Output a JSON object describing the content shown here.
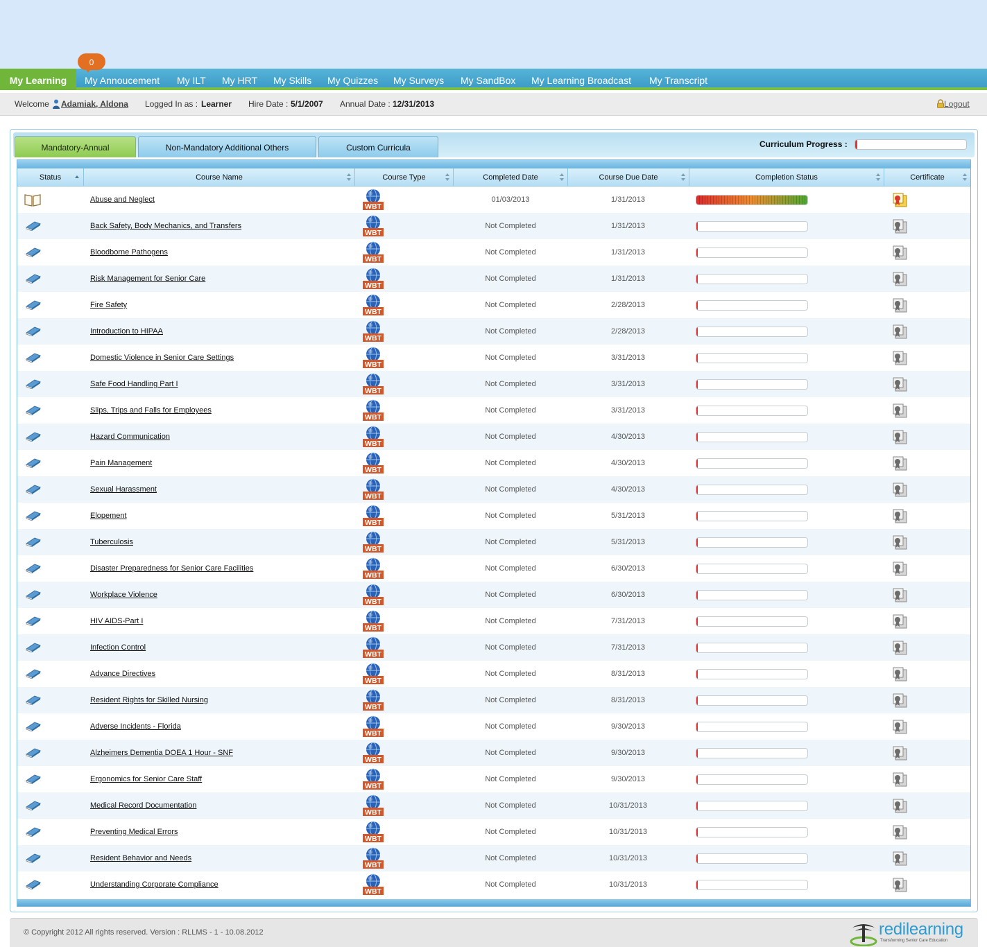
{
  "nav": {
    "items": [
      "My Learning",
      "My Annoucement",
      "My ILT",
      "My HRT",
      "My Skills",
      "My Quizzes",
      "My Surveys",
      "My SandBox",
      "My Learning Broadcast",
      "My Transcript"
    ],
    "announcement_badge": "0"
  },
  "userbar": {
    "welcome_label": "Welcome",
    "user_name": "Adamiak, Aldona",
    "logged_in_label": "Logged In as :",
    "role": "Learner",
    "hire_label": "Hire Date :",
    "hire_date": "5/1/2007",
    "annual_label": "Annual Date :",
    "annual_date": "12/31/2013",
    "logout": "Logout"
  },
  "tabs": [
    "Mandatory-Annual",
    "Non-Mandatory Additional Others",
    "Custom Curricula"
  ],
  "curriculum_progress": {
    "label": "Curriculum Progress :",
    "value_fraction": 0.02
  },
  "columns": [
    "Status",
    "Course Name",
    "Course Type",
    "Completed Date",
    "Course Due Date",
    "Completion Status",
    "Certificate"
  ],
  "course_type_badge": "WBT",
  "courses": [
    {
      "name": "Abuse and Neglect",
      "completed": "01/03/2013",
      "due": "1/31/2013",
      "progress": 1.0,
      "status": "open-book-icon",
      "certificate": "certificate-available-icon"
    },
    {
      "name": "Back Safety, Body Mechanics, and Transfers",
      "completed": "Not Completed",
      "due": "1/31/2013",
      "progress": 0.0
    },
    {
      "name": "Bloodborne Pathogens",
      "completed": "Not Completed",
      "due": "1/31/2013",
      "progress": 0.0
    },
    {
      "name": "Risk Management for Senior Care",
      "completed": "Not Completed",
      "due": "1/31/2013",
      "progress": 0.0
    },
    {
      "name": "Fire Safety",
      "completed": "Not Completed",
      "due": "2/28/2013",
      "progress": 0.0
    },
    {
      "name": "Introduction to HIPAA",
      "completed": "Not Completed",
      "due": "2/28/2013",
      "progress": 0.0
    },
    {
      "name": "Domestic Violence in Senior Care Settings",
      "completed": "Not Completed",
      "due": "3/31/2013",
      "progress": 0.0
    },
    {
      "name": "Safe Food Handling Part I",
      "completed": "Not Completed",
      "due": "3/31/2013",
      "progress": 0.0
    },
    {
      "name": "Slips, Trips and Falls for Employees",
      "completed": "Not Completed",
      "due": "3/31/2013",
      "progress": 0.0
    },
    {
      "name": "Hazard Communication",
      "completed": "Not Completed",
      "due": "4/30/2013",
      "progress": 0.0
    },
    {
      "name": "Pain Management",
      "completed": "Not Completed",
      "due": "4/30/2013",
      "progress": 0.0
    },
    {
      "name": "Sexual Harassment",
      "completed": "Not Completed",
      "due": "4/30/2013",
      "progress": 0.0
    },
    {
      "name": "Elopement",
      "completed": "Not Completed",
      "due": "5/31/2013",
      "progress": 0.0
    },
    {
      "name": "Tuberculosis",
      "completed": "Not Completed",
      "due": "5/31/2013",
      "progress": 0.0
    },
    {
      "name": "Disaster Preparedness for Senior Care Facilities",
      "completed": "Not Completed",
      "due": "6/30/2013",
      "progress": 0.0
    },
    {
      "name": "Workplace Violence",
      "completed": "Not Completed",
      "due": "6/30/2013",
      "progress": 0.0
    },
    {
      "name": "HIV AIDS-Part I",
      "completed": "Not Completed",
      "due": "7/31/2013",
      "progress": 0.0
    },
    {
      "name": "Infection Control",
      "completed": "Not Completed",
      "due": "7/31/2013",
      "progress": 0.0
    },
    {
      "name": "Advance Directives",
      "completed": "Not Completed",
      "due": "8/31/2013",
      "progress": 0.0
    },
    {
      "name": "Resident Rights for Skilled Nursing",
      "completed": "Not Completed",
      "due": "8/31/2013",
      "progress": 0.0
    },
    {
      "name": "Adverse Incidents - Florida",
      "completed": "Not Completed",
      "due": "9/30/2013",
      "progress": 0.0
    },
    {
      "name": "Alzheimers Dementia DOEA 1 Hour - SNF",
      "completed": "Not Completed",
      "due": "9/30/2013",
      "progress": 0.0
    },
    {
      "name": "Ergonomics for Senior Care Staff",
      "completed": "Not Completed",
      "due": "9/30/2013",
      "progress": 0.0
    },
    {
      "name": "Medical Record Documentation",
      "completed": "Not Completed",
      "due": "10/31/2013",
      "progress": 0.0
    },
    {
      "name": "Preventing Medical Errors",
      "completed": "Not Completed",
      "due": "10/31/2013",
      "progress": 0.0
    },
    {
      "name": "Resident Behavior and Needs",
      "completed": "Not Completed",
      "due": "10/31/2013",
      "progress": 0.0
    },
    {
      "name": "Understanding Corporate Compliance",
      "completed": "Not Completed",
      "due": "10/31/2013",
      "progress": 0.0
    }
  ],
  "footer": {
    "copyright": "© Copyright 2012 All rights reserved.   Version : RLLMS - 1 - 10.08.2012",
    "brand": "redilearning",
    "tagline": "Transforming Senior Care Education"
  },
  "colors": {
    "nav_bg": "#3d9dc8",
    "nav_active": "#6fb63b",
    "badge": "#e26f22",
    "wbt_badge": "#d2572a",
    "progress_empty": "#e13434"
  }
}
